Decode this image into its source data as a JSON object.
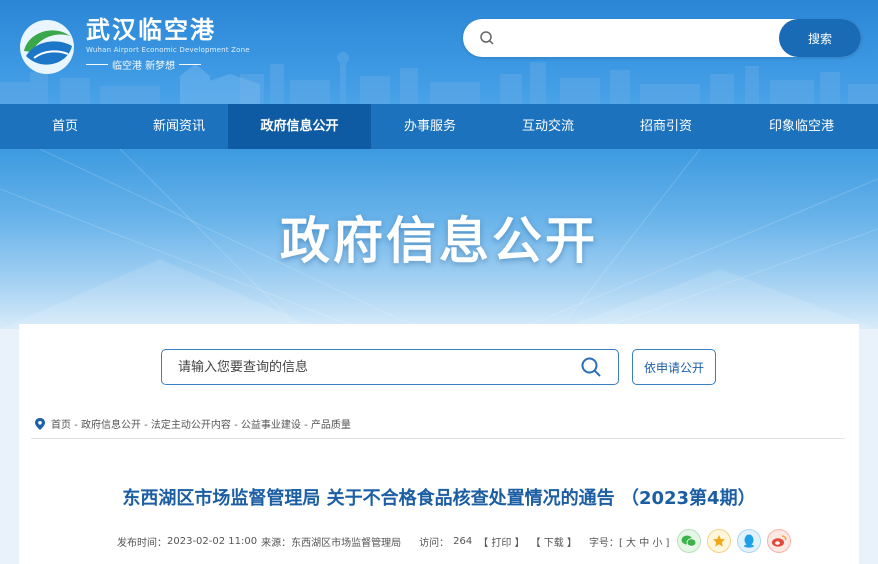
{
  "header": {
    "logo_cn": "武汉临空港",
    "logo_en": "Wuhan Airport Economic Development Zone",
    "logo_slogan": "临空港 新梦想",
    "search_placeholder": "",
    "search_button": "搜索"
  },
  "nav": {
    "items": [
      {
        "label": "首页"
      },
      {
        "label": "新闻资讯"
      },
      {
        "label": "政府信息公开"
      },
      {
        "label": "办事服务"
      },
      {
        "label": "互动交流"
      },
      {
        "label": "招商引资"
      },
      {
        "label": "印象临空港"
      }
    ],
    "active": "政府信息公开"
  },
  "banner": {
    "title": "政府信息公开"
  },
  "info_search": {
    "placeholder": "请输入您要查询的信息",
    "apply_button": "依申请公开"
  },
  "breadcrumb": "首页 - 政府信息公开 - 法定主动公开内容 - 公益事业建设 - 产品质量",
  "article": {
    "title": "东西湖区市场监督管理局 关于不合格食品核查处置情况的通告 （2023第4期）",
    "meta": {
      "publish_label": "发布时间：",
      "publish_time": "2023-02-02 11:00",
      "source_label": "来源：",
      "source": "东西湖区市场监督管理局",
      "visits_label": "访问：",
      "visits": "264",
      "print": "【 打印 】",
      "download": "【 下载 】",
      "fontsize_label": "字号：",
      "fontsize_options": "[ 大 中 小 ]"
    }
  },
  "share_icons": [
    "wechat-icon",
    "star-icon",
    "qq-icon",
    "weibo-icon"
  ],
  "colors": {
    "header_blue": "#2b86d6",
    "nav_blue": "#1d72bd",
    "nav_active": "#0e5ba3",
    "title_blue": "#1b5ea3"
  }
}
